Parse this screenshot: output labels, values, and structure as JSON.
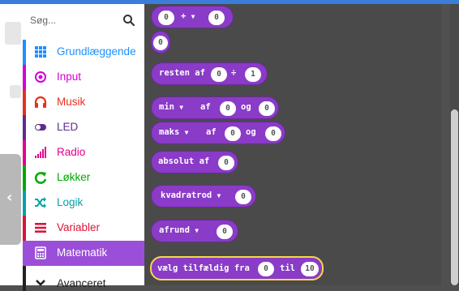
{
  "colors": {
    "accent_blue": "#3b7dd8",
    "toolbox_selected_bg": "#9b4fd8",
    "math_block": "#8a3bc7",
    "flyout_bg": "#4a4a4a",
    "selection_outline": "#f5d84a"
  },
  "search": {
    "placeholder": "Søg...",
    "icon": "search-icon"
  },
  "toolbox": {
    "categories": [
      {
        "label": "Grundlæggende",
        "icon": "grid-icon",
        "color": "#1e90ff"
      },
      {
        "label": "Input",
        "icon": "radio-circle-icon",
        "color": "#d400d4"
      },
      {
        "label": "Musik",
        "icon": "headphones-icon",
        "color": "#e63022"
      },
      {
        "label": "LED",
        "icon": "toggle-icon",
        "color": "#5c2d91"
      },
      {
        "label": "Radio",
        "icon": "signal-bars-icon",
        "color": "#e3008c"
      },
      {
        "label": "Løkker",
        "icon": "refresh-icon",
        "color": "#00aa00"
      },
      {
        "label": "Logik",
        "icon": "shuffle-icon",
        "color": "#00a4a6"
      },
      {
        "label": "Variabler",
        "icon": "list-icon",
        "color": "#dc143c"
      },
      {
        "label": "Matematik",
        "icon": "calculator-icon",
        "color": "#9b4fd8",
        "selected": true
      },
      {
        "label": "Avanceret",
        "icon": "chevron-down-icon",
        "color": "#222222"
      }
    ]
  },
  "blocks": {
    "b0": {
      "left": "0",
      "op": "+",
      "right": "0"
    },
    "b1": {
      "value": "0"
    },
    "b2": {
      "text": "resten af",
      "left": "0",
      "sym": "÷",
      "right": "1"
    },
    "b3": {
      "fn": "min",
      "af": "af",
      "a": "0",
      "og": "og",
      "b": "0"
    },
    "b4": {
      "fn": "maks",
      "af": "af",
      "a": "0",
      "og": "og",
      "b": "0"
    },
    "b5": {
      "text": "absolut af",
      "value": "0"
    },
    "b6": {
      "fn": "kvadratrod",
      "value": "0"
    },
    "b7": {
      "fn": "afrund",
      "value": "0"
    },
    "b8": {
      "text": "vælg tilfældig fra",
      "from": "0",
      "til": "til",
      "to": "10"
    }
  }
}
